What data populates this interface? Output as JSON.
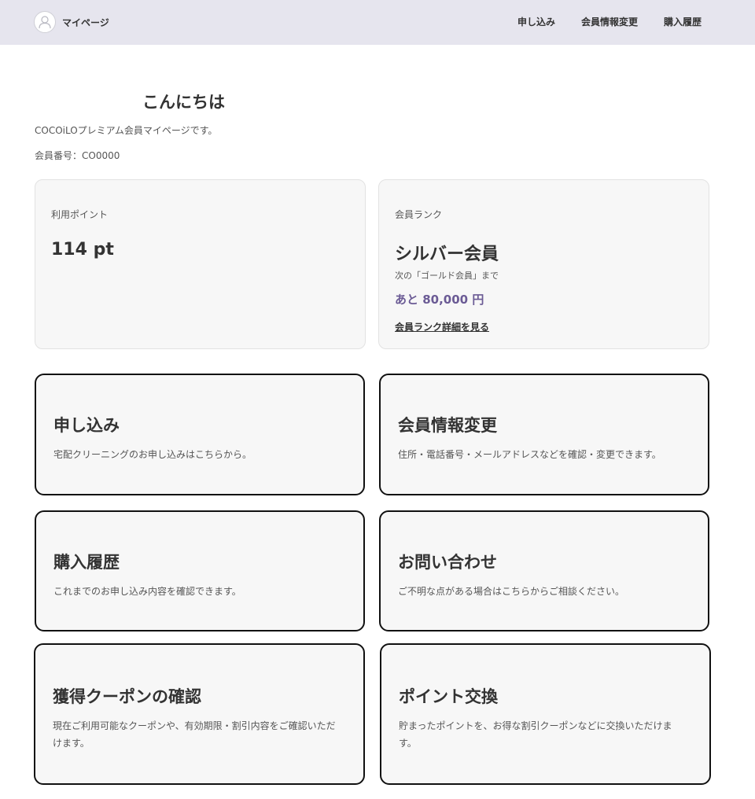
{
  "header": {
    "brand_label": "マイページ",
    "nav": [
      "申し込み",
      "会員情報変更",
      "購入履歴"
    ]
  },
  "main": {
    "greeting": "こんにちは",
    "intro": "COCOiLOプレミアム会員マイページです。",
    "member_number": "会員番号：CO0000"
  },
  "points_card": {
    "label": "利用ポイント",
    "value": "114 pt"
  },
  "rank_card": {
    "label": "会員ランク",
    "rank": "シルバー会員",
    "next_rank_text": "次の「ゴールド会員」まで",
    "remaining": "あと 80,000 円",
    "detail_link": "会員ランク詳細を見る"
  },
  "tiles": [
    {
      "title": "申し込み",
      "description": "宅配クリーニングのお申し込みはこちらから。"
    },
    {
      "title": "会員情報変更",
      "description": "住所・電話番号・メールアドレスなどを確認・変更できます。"
    },
    {
      "title": "購入履歴",
      "description": "これまでのお申し込み内容を確認できます。"
    },
    {
      "title": "お問い合わせ",
      "description": "ご不明な点がある場合はこちらからご相談ください。"
    },
    {
      "title": "獲得クーポンの確認",
      "description": "現在ご利用可能なクーポンや、有効期限・割引内容をご確認いただけます。"
    },
    {
      "title": "ポイント交換",
      "description": "貯まったポイントを、お得な割引クーポンなどに交換いただけます。"
    }
  ],
  "colors": {
    "header_bg": "#e6e5ee",
    "accent": "#6b5b95",
    "card_bg": "#f7f7f7"
  },
  "icons": {
    "avatar": "user-avatar-icon"
  }
}
